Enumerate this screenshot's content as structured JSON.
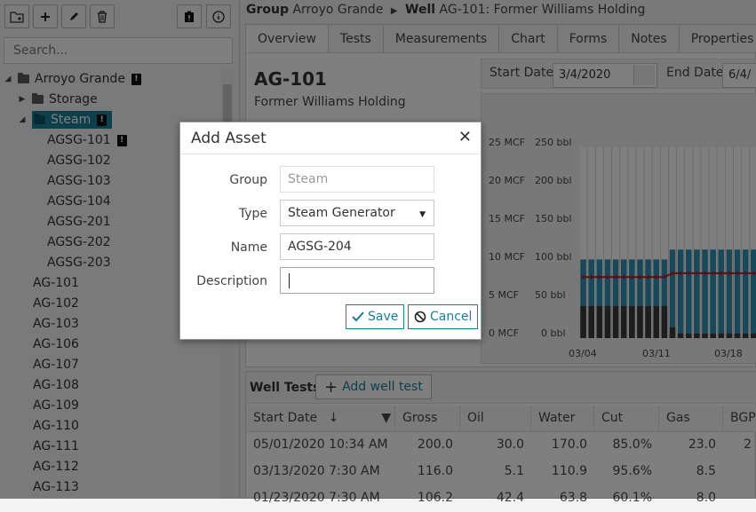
{
  "toolbar": {
    "add_folder_icon": "add-folder-icon",
    "add_icon": "plus-icon",
    "edit_icon": "pencil-icon",
    "delete_icon": "trash-icon",
    "clipboard_icon": "clipboard-icon",
    "info_icon": "info-icon"
  },
  "search": {
    "placeholder": "Search..."
  },
  "tree": {
    "root": "Arroyo Grande",
    "storage": "Storage",
    "steam": "Steam",
    "steam_children": [
      "AGSG-101",
      "AGSG-102",
      "AGSG-103",
      "AGSG-104",
      "AGSG-201",
      "AGSG-202",
      "AGSG-203"
    ],
    "wells": [
      "AG-101",
      "AG-102",
      "AG-103",
      "AG-106",
      "AG-107",
      "AG-108",
      "AG-109",
      "AG-110",
      "AG-111",
      "AG-112",
      "AG-113"
    ]
  },
  "breadcrumb": {
    "group_label": "Group",
    "group_value": "Arroyo Grande",
    "well_label": "Well",
    "well_value": "AG-101: Former Williams Holding"
  },
  "tabs": [
    "Overview",
    "Tests",
    "Measurements",
    "Chart",
    "Forms",
    "Notes",
    "Properties"
  ],
  "overview": {
    "asset_name": "AG-101",
    "asset_description": "Former Williams Holding",
    "start_date_label": "Start Date",
    "start_date_value": "3/4/2020",
    "end_date_label": "End Date",
    "end_date_value": "6/4/"
  },
  "chart_data": {
    "type": "bar",
    "y_axes": [
      {
        "ticks": [
          "0 MCF",
          "5 MCF",
          "10 MCF",
          "15 MCF",
          "20 MCF",
          "25 MCF"
        ]
      },
      {
        "ticks": [
          "0 bbl",
          "50 bbl",
          "100 bbl",
          "150 bbl",
          "200 bbl",
          "250 bbl"
        ]
      }
    ],
    "x_ticks": [
      "03/04",
      "03/11",
      "03/18"
    ],
    "ylim_bbl": [
      0,
      250
    ],
    "colors": {
      "water": "#2e93b5",
      "oil": "#3a3a3a",
      "gas_line": "#c0182b"
    },
    "series": [
      {
        "values": [
          103,
          103,
          103,
          103,
          103,
          103,
          103,
          103,
          103,
          103,
          103,
          116,
          116,
          116,
          116,
          116,
          116,
          116,
          116,
          116,
          116,
          116,
          116
        ]
      },
      {
        "values": [
          42,
          42,
          42,
          42,
          42,
          42,
          42,
          42,
          42,
          42,
          42,
          14,
          6,
          6,
          6,
          6,
          6,
          6,
          6,
          6,
          6,
          6,
          6
        ]
      },
      {
        "values": [
          8.0,
          8.0,
          8.0,
          8.0,
          8.0,
          8.0,
          8.0,
          8.0,
          8.0,
          8.0,
          8.0,
          8.5,
          8.5,
          8.5,
          8.5,
          8.5,
          8.5,
          8.5,
          8.5,
          8.5,
          8.5,
          8.5,
          8.5
        ]
      }
    ]
  },
  "well_tests": {
    "title": "Well Tests",
    "add_label": "Add well test",
    "columns": [
      "Start Date",
      "Gross",
      "Oil",
      "Water",
      "Cut",
      "Gas",
      "BGPD"
    ],
    "rows": [
      [
        "05/01/2020 10:34 AM",
        "200.0",
        "30.0",
        "170.0",
        "85.0%",
        "23.0",
        "2"
      ],
      [
        "03/13/2020 7:30 AM",
        "116.0",
        "5.1",
        "110.9",
        "95.6%",
        "8.5",
        ""
      ],
      [
        "01/23/2020 7:30 AM",
        "106.2",
        "42.4",
        "63.8",
        "60.1%",
        "8.0",
        ""
      ]
    ]
  },
  "dialog": {
    "title": "Add Asset",
    "group_label": "Group",
    "group_value": "Steam",
    "type_label": "Type",
    "type_value": "Steam Generator",
    "name_label": "Name",
    "name_value": "AGSG-204",
    "description_label": "Description",
    "description_value": "",
    "save_label": "Save",
    "cancel_label": "Cancel"
  }
}
